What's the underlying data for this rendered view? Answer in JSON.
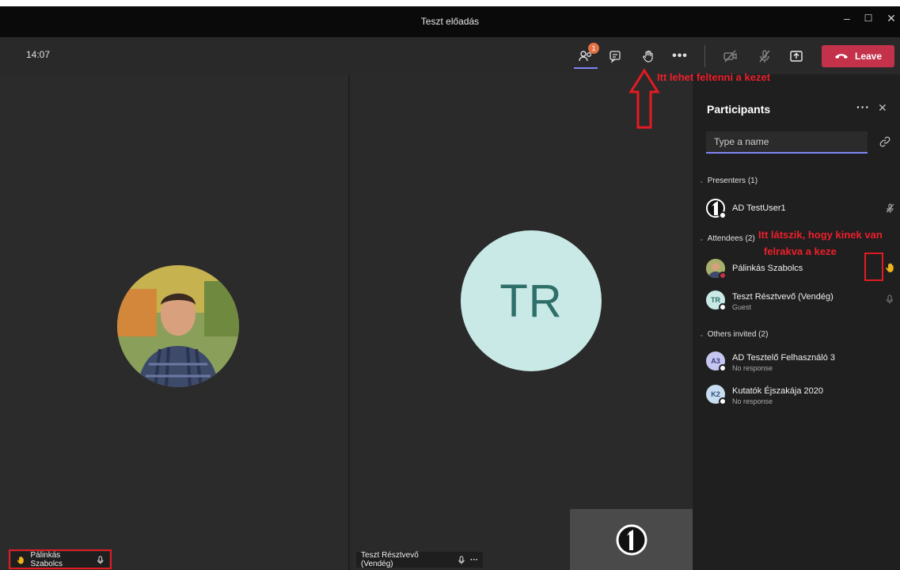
{
  "window": {
    "title": "Teszt előadás",
    "minimize": "–",
    "maximize": "☐",
    "close": "✕"
  },
  "toolbar": {
    "time": "14:07",
    "participants_badge": "1",
    "leave_label": "Leave"
  },
  "stage": {
    "left_name": "Pálinkás Szabolcs",
    "right_initials": "TR",
    "right_name": "Teszt Résztvevő (Vendég)",
    "right_more": "···"
  },
  "panel": {
    "title": "Participants",
    "more": "···",
    "close": "✕",
    "search_placeholder": "Type a name",
    "presenters_header": "Presenters (1)",
    "attendees_header": "Attendees (2)",
    "others_header": "Others invited (2)",
    "presenters": [
      {
        "name": "AD TestUser1"
      }
    ],
    "attendees": [
      {
        "name": "Pálinkás Szabolcs"
      },
      {
        "name": "Teszt Résztvevő (Vendég)",
        "subtitle": "Guest",
        "initials": "TR"
      }
    ],
    "others": [
      {
        "name": "AD Tesztelő Felhasználó 3",
        "subtitle": "No response",
        "initials": "A3"
      },
      {
        "name": "Kutatók Éjszakája 2020",
        "subtitle": "No response",
        "initials": "K2"
      }
    ]
  },
  "annotations": {
    "raise_hand_note": "Itt lehet feltenni a kezet",
    "who_raised_line1": "Itt látszik, hogy kinek van",
    "who_raised_line2": "felrakva  a keze"
  },
  "colors": {
    "accent": "#7f85f5",
    "leave": "#c4314b",
    "annotation": "#e21b22",
    "hand": "#f2b21b"
  }
}
